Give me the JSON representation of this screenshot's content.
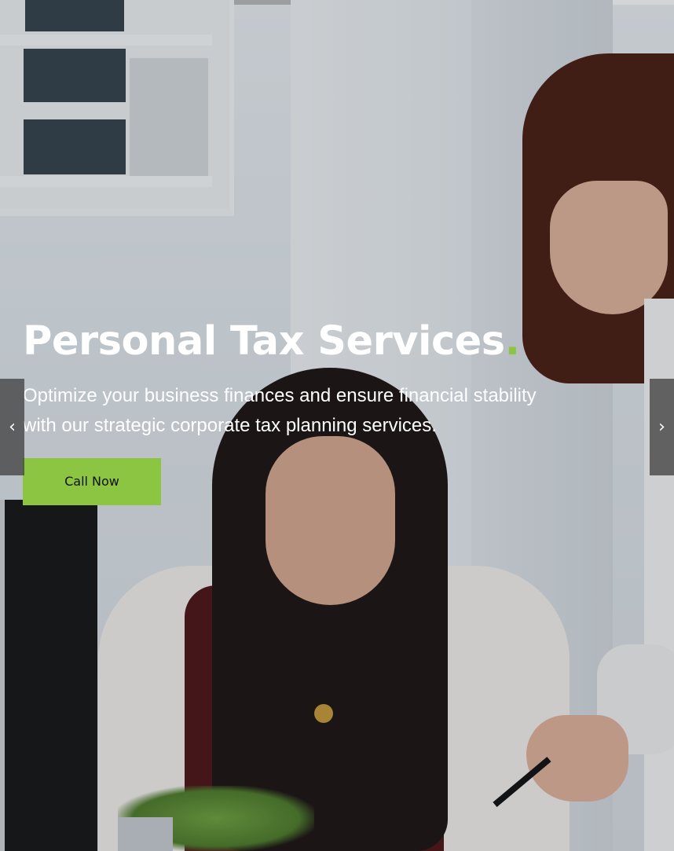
{
  "slide": {
    "title": "Personal Tax Services",
    "title_accent": ".",
    "subtitle": "Optimize your business finances and ensure financial stability with our strategic corporate tax planning services.",
    "cta_label": "Call Now"
  },
  "navigation": {
    "prev_icon": "‹",
    "next_icon": "›"
  },
  "progress": {
    "fraction": 0.635
  },
  "colors": {
    "accent": "#8bc541",
    "text": "#ffffff",
    "arrow_bg": "#3c3c3c"
  }
}
